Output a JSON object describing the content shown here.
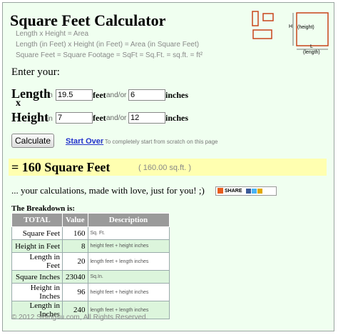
{
  "title": "Square Feet Calculator",
  "formulas": [
    "Length x Height = Area",
    "Length (in Feet) x Height (in Feet) = Area (in Square Feet)",
    "Square Feet = Square Footage = SqFt = Sq.Ft. = sq.ft. = ft²"
  ],
  "diagram": {
    "height_label": "H",
    "height_text": "(height)",
    "length_label": "L",
    "length_text": "(length)"
  },
  "enter_your": "Enter your:",
  "length": {
    "label": "Length",
    "in": "in",
    "feet_value": "19.5",
    "feet_label": "feet",
    "andor": "and/or",
    "inches_value": "6",
    "inches_label": "inches"
  },
  "times": "x",
  "height": {
    "label": "Height",
    "in": "in",
    "feet_value": "7",
    "feet_label": "feet",
    "andor": "and/or",
    "inches_value": "12",
    "inches_label": "inches"
  },
  "calculate_label": "Calculate",
  "start_over_label": "Start Over",
  "start_over_note": "- To completely start from scratch on this page",
  "result": "= 160 Square Feet",
  "result_sub": "( 160.00 sq.ft. )",
  "love_text": "... your calculations, made with love, just for you!   ;)",
  "share_label": "SHARE",
  "breakdown_title": "The Breakdown is:",
  "table": {
    "headers": [
      "TOTAL",
      "Value",
      "Description"
    ],
    "rows": [
      {
        "name": "Square Feet",
        "value": "160",
        "desc": "Sq. Ft."
      },
      {
        "name": "Height in Feet",
        "value": "8",
        "desc": "height feet + height inches"
      },
      {
        "name": "Length in Feet",
        "value": "20",
        "desc": "length feet + length inches"
      },
      {
        "name": "Square Inches",
        "value": "23040",
        "desc": "Sq.In."
      },
      {
        "name": "Height in Inches",
        "value": "96",
        "desc": "height feet + height inches"
      },
      {
        "name": "Length in Inches",
        "value": "240",
        "desc": "length feet + length inches"
      }
    ]
  },
  "footer": "© 2012 Siding4u.com, All Rights Reserved.",
  "colors": {
    "background": "#f0fff0",
    "result_bar": "#ffffb0",
    "diagram": "#c8441a",
    "header_row": "#9a9a9a",
    "alt_row": "#dcf5dc",
    "link": "#2233cc"
  }
}
